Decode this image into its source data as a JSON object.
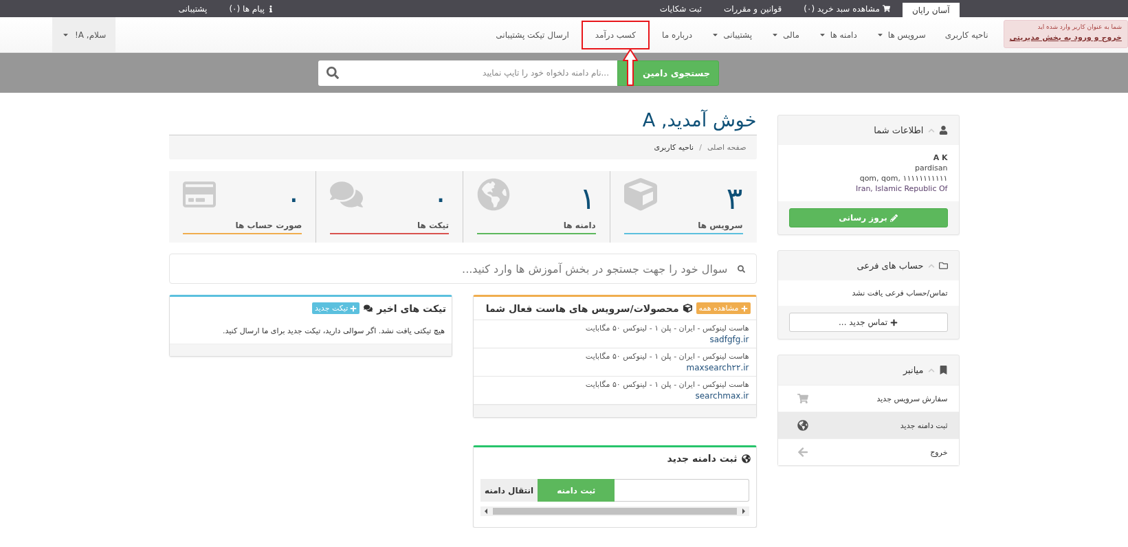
{
  "top_bar": {
    "right_items": [
      {
        "label": "آسان رایان",
        "kind": "plain",
        "selected": true
      },
      {
        "label": "مشاهده سبد خرید (۰)",
        "kind": "cart",
        "selected": false
      },
      {
        "label": "قوانین و مقررات",
        "kind": "plain",
        "selected": false
      },
      {
        "label": "ثبت شکایات",
        "kind": "plain",
        "selected": false
      }
    ],
    "left_items": [
      {
        "label": "پیام ها (۰)",
        "kind": "info"
      },
      {
        "label": "پشتیبانی",
        "kind": "plain"
      }
    ]
  },
  "admin_notice": {
    "text": "شما به عنوان کاربر وارد شده اید",
    "link": "خروج و ورود به بخش مدیریتی"
  },
  "nav": {
    "items": [
      {
        "label": "ناحیه کاربری",
        "dropdown": false,
        "highlighted": false
      },
      {
        "label": "سرویس ها",
        "dropdown": true,
        "highlighted": false
      },
      {
        "label": "دامنه ها",
        "dropdown": true,
        "highlighted": false
      },
      {
        "label": "مالی",
        "dropdown": true,
        "highlighted": false
      },
      {
        "label": "پشتیبانی",
        "dropdown": true,
        "highlighted": false
      },
      {
        "label": "درباره ما",
        "dropdown": false,
        "highlighted": false
      },
      {
        "label": "کسب درآمد",
        "dropdown": false,
        "highlighted": true
      },
      {
        "label": "ارسال تیکت پشتیبانی",
        "dropdown": false,
        "highlighted": false
      }
    ],
    "greeting": "سلام, A!"
  },
  "domain_search": {
    "button": "جستجوی دامین",
    "placeholder": "...نام دامنه دلخواه خود را تایپ نمایید"
  },
  "welcome": "خوش آمدید, A",
  "breadcrumb_separator": "/",
  "breadcrumb": [
    {
      "label": "صفحه اصلی",
      "current": false
    },
    {
      "label": "ناحیه کاربری",
      "current": true
    }
  ],
  "stats": [
    {
      "kind": "services",
      "count": "۳",
      "label": "سرویس ها",
      "color": "#5bc0de"
    },
    {
      "kind": "domains",
      "count": "۱",
      "label": "دامنه ها",
      "color": "#5cb85c"
    },
    {
      "kind": "tickets",
      "count": "۰",
      "label": "تیکت ها",
      "color": "#d9534f"
    },
    {
      "kind": "invoices",
      "count": "۰",
      "label": "صورت حساب ها",
      "color": "#f0ad4e"
    }
  ],
  "kb_search": {
    "placeholder": "سوال خود را جهت جستجو در بخش آموزش ها وارد کنید..."
  },
  "products_panel": {
    "title": "محصولات/سرویس های هاست فعال شما",
    "button": "مشاهده همه",
    "items": [
      {
        "title": "هاست لینوکس - ایران - پلن ۱ - لینوکس ۵۰ مگابایت",
        "domain": "sadfgfg.ir"
      },
      {
        "title": "هاست لینوکس - ایران - پلن ۱ - لینوکس ۵۰ مگابایت",
        "domain": "maxsearch۲۲.ir"
      },
      {
        "title": "هاست لینوکس - ایران - پلن ۱ - لینوکس ۵۰ مگابایت",
        "domain": "searchmax.ir"
      }
    ]
  },
  "tickets_panel": {
    "title": "تیکت های اخیر",
    "button": "تیکت جدید",
    "message": "هیچ تیکتی یافت نشد. اگر سوالی دارید، تیکت جدید برای ما ارسال کنید."
  },
  "domain_panel": {
    "title": "ثبت دامنه جدید",
    "register_button": "ثبت دامنه",
    "transfer_button": "انتقال دامنه"
  },
  "sidebar": [
    {
      "kind": "info",
      "title": "اطلاعات شما",
      "name": "A K",
      "company": "pardisan",
      "address": "qom, qom, ۱۱۱۱۱۱۱۱۱۱۱",
      "country": "Iran, Islamic Republic Of",
      "button": "بروز رسانی"
    },
    {
      "kind": "contacts",
      "title": "حساب های فرعی",
      "message": "تماس/حساب فرعی یافت نشد",
      "button": "تماس جدید ..."
    },
    {
      "kind": "shortcuts",
      "title": "میانبر",
      "items": [
        {
          "label": "سفارش سرویس جدید",
          "kind": "cart",
          "highlighted": false
        },
        {
          "label": "ثبت دامنه جدید",
          "kind": "globe",
          "highlighted": true
        },
        {
          "label": "خروج",
          "kind": "logout",
          "highlighted": false
        }
      ]
    }
  ]
}
